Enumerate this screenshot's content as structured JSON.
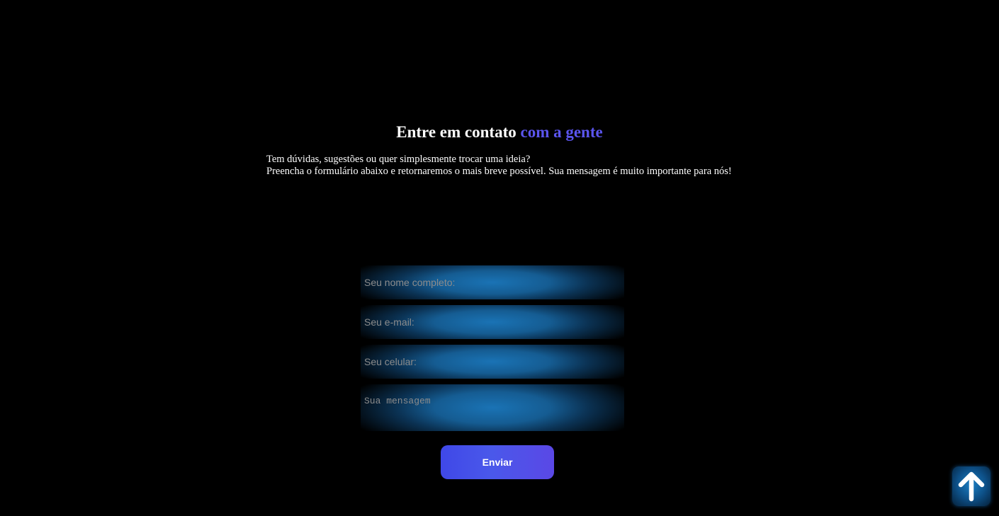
{
  "header": {
    "title_main": "Entre em contato",
    "title_accent": "com a gente"
  },
  "intro": {
    "line1": "Tem dúvidas, sugestões ou quer simplesmente trocar uma ideia?",
    "line2": "Preencha o formulário abaixo e retornaremos o mais breve possível. Sua mensagem é muito importante para nós!"
  },
  "form": {
    "name_placeholder": "Seu nome completo:",
    "email_placeholder": "Seu e-mail:",
    "phone_placeholder": "Seu celular:",
    "message_placeholder": "Sua mensagem",
    "submit_label": "Enviar"
  },
  "back_to_top": {
    "icon": "arrow-up-icon"
  },
  "colors": {
    "background": "#000000",
    "accent": "#5b55ee",
    "field_glow": "#1a73b5",
    "button_gradient_start": "#3f48e8",
    "button_gradient_end": "#5a48e6"
  }
}
